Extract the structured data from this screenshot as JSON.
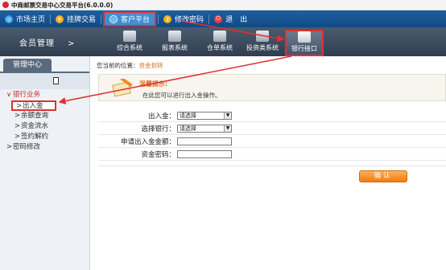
{
  "window": {
    "title": "中商邮票交易中心交易平台(6.0.0.0)"
  },
  "topnav": {
    "items": [
      {
        "label": "市场主页",
        "icon": "globe-icon",
        "color": "#3aa0e0"
      },
      {
        "label": "挂牌交易",
        "icon": "yen-icon",
        "color": "#f0b020"
      },
      {
        "label": "客户平台",
        "icon": "globe-icon",
        "color": "#3aa0e0",
        "active": true
      },
      {
        "label": "修改密码",
        "icon": "key-icon",
        "color": "#f0b020"
      },
      {
        "label": "退　出",
        "icon": "power-icon",
        "color": "#e04040"
      }
    ]
  },
  "modules": {
    "title": "会员管理",
    "arrow": ">",
    "items": [
      {
        "label": "综合系统",
        "icon": "monitor-icon"
      },
      {
        "label": "报表系统",
        "icon": "report-icon"
      },
      {
        "label": "仓单系统",
        "icon": "warehouse-icon"
      },
      {
        "label": "投资类系统",
        "icon": "chart-icon"
      },
      {
        "label": "银行接口",
        "icon": "bank-gear-icon",
        "active": true
      }
    ]
  },
  "sidebar": {
    "tab": "管理中心",
    "items": [
      {
        "label": "银行业务",
        "type": "group",
        "chev": "∨"
      },
      {
        "label": "出入金",
        "type": "sub",
        "chev": ">",
        "active": true
      },
      {
        "label": "余额查询",
        "type": "sub",
        "chev": ">"
      },
      {
        "label": "资金流水",
        "type": "sub",
        "chev": ">"
      },
      {
        "label": "签约解约",
        "type": "sub",
        "chev": ">"
      },
      {
        "label": "密码修改",
        "type": "root",
        "chev": ">"
      }
    ]
  },
  "content": {
    "breadcrumb_prefix": "您当前的位置：",
    "breadcrumb_current": "资金划转",
    "tip_title": "温馨提示:",
    "tip_text": "在此您可以进行出入金操作。",
    "form": {
      "direction_label": "出入金：",
      "direction_value": "请选择",
      "bank_label": "选择银行：",
      "bank_value": "请选择",
      "amount_label": "申请出入金金额：",
      "amount_value": "",
      "password_label": "资金密码：",
      "password_value": ""
    },
    "confirm_label": "确认"
  },
  "colors": {
    "accent_red": "#e03030",
    "nav_blue": "#0f4a86",
    "module_dark": "#2f3d4f",
    "confirm_orange": "#f07c10"
  }
}
